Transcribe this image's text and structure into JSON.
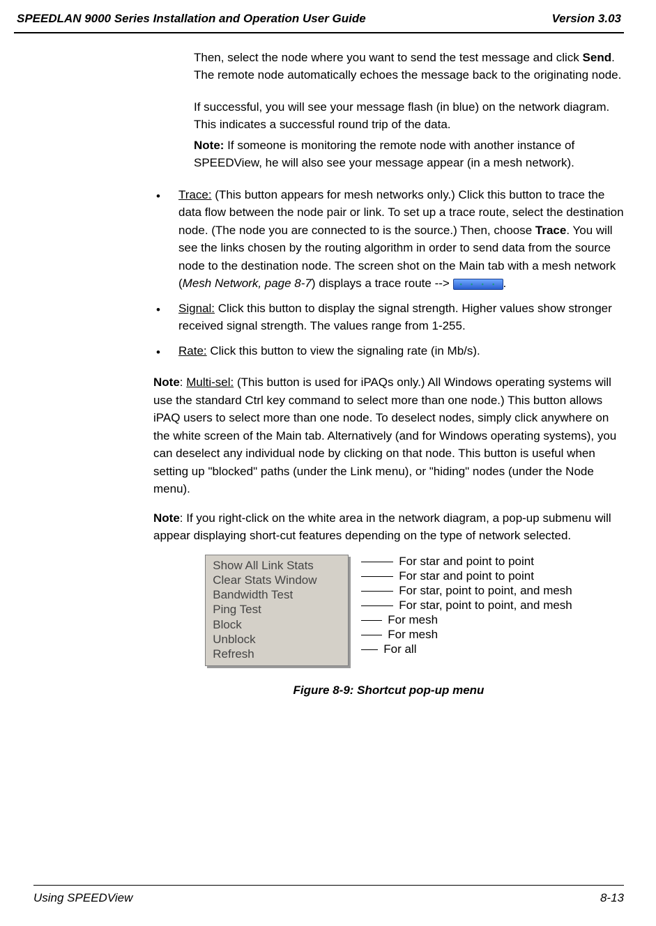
{
  "header": {
    "title": "SPEEDLAN 9000 Series Installation and Operation User Guide",
    "version": "Version 3.03"
  },
  "intro": {
    "p1a": "Then, select the node where you want to send the test message and click ",
    "send": "Send",
    "p1b": ". The remote node automatically echoes the message back to the originating node.",
    "p2": "If successful, you will see your message flash (in blue) on the network diagram. This indicates a successful round trip of the data.",
    "noteLabel": "Note:",
    "p3": " If someone is monitoring the remote node with another instance of SPEEDView, he will also see your message appear (in a mesh network)."
  },
  "bullets": {
    "trace": {
      "label": "Trace:",
      "t1": " (This button appears for mesh networks only.) Click this button to trace the data flow between the node pair or link. To set up a trace route, select the destination node. (The node you are connected to is the source.) Then, choose ",
      "bold": "Trace",
      "t2": ". You will see the links chosen by the routing algorithm in order to send data from the source node to the destination node. The screen shot on the Main tab with a mesh network (",
      "ital": "Mesh Network, page 8-7",
      "t3": ") displays a trace route --> ",
      "t4": "."
    },
    "signal": {
      "label": "Signal:",
      "text": " Click this button to display the signal strength. Higher values show stronger received signal strength. The values range from 1-255."
    },
    "rate": {
      "label": "Rate:",
      "text": " Click this button to view the signaling rate (in Mb/s)."
    }
  },
  "notes": {
    "label1": "Note",
    "multi_label": "Multi-sel:",
    "multi_text": " (This button is used for iPAQs only.) All Windows operating systems will use the standard Ctrl key command to select more than one node.) This button allows iPAQ users to select more than one node. To deselect nodes, simply click anywhere on the white screen of the Main tab. Alternatively (and for Windows operating systems), you can deselect any individual node by clicking on that node. This button is useful when setting up \"blocked\" paths (under the Link menu), or \"hiding\" nodes (under the Node menu).",
    "label2": "Note",
    "rc_text": ": If you right-click on the white area in the network diagram, a pop-up submenu will appear displaying short-cut features depending on the type of network selected."
  },
  "menu": {
    "items": [
      "Show All Link Stats",
      "Clear Stats Window",
      "Bandwidth Test",
      "Ping Test",
      "Block",
      "Unblock",
      "Refresh"
    ],
    "annotations": [
      "For star and point to point",
      "For star and point to point",
      "For star, point to point, and mesh",
      "For star, point to point, and mesh",
      "For mesh",
      "For mesh",
      "For all"
    ]
  },
  "figure_caption": "Figure 8-9: Shortcut pop-up menu",
  "footer": {
    "left": "Using SPEEDView",
    "right": "8-13"
  }
}
